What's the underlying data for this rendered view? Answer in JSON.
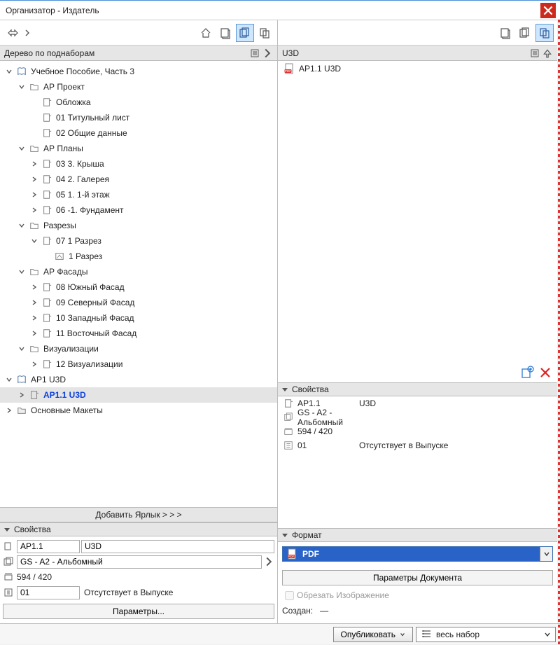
{
  "window": {
    "title": "Организатор - Издатель"
  },
  "left": {
    "header": "Дерево по поднаборам",
    "add_shortcut": "Добавить Ярлык > > >",
    "tree": [
      {
        "depth": 0,
        "expand": "open",
        "icon": "book",
        "label": "Учебное Пособие, Часть 3"
      },
      {
        "depth": 1,
        "expand": "open",
        "icon": "folder",
        "label": "АР Проект"
      },
      {
        "depth": 2,
        "expand": "none",
        "icon": "sheet",
        "label": "Обложка"
      },
      {
        "depth": 2,
        "expand": "none",
        "icon": "sheet",
        "label": "01 Титульный лист"
      },
      {
        "depth": 2,
        "expand": "none",
        "icon": "sheet",
        "label": "02 Общие данные"
      },
      {
        "depth": 1,
        "expand": "open",
        "icon": "folder",
        "label": "АР Планы"
      },
      {
        "depth": 2,
        "expand": "closed",
        "icon": "sheet",
        "label": "03 3. Крыша"
      },
      {
        "depth": 2,
        "expand": "closed",
        "icon": "sheet",
        "label": "04 2. Галерея"
      },
      {
        "depth": 2,
        "expand": "closed",
        "icon": "sheet",
        "label": "05 1. 1-й этаж"
      },
      {
        "depth": 2,
        "expand": "closed",
        "icon": "sheet",
        "label": "06 -1. Фундамент"
      },
      {
        "depth": 1,
        "expand": "open",
        "icon": "folder",
        "label": "Разрезы"
      },
      {
        "depth": 2,
        "expand": "open",
        "icon": "sheet",
        "label": "07 1 Разрез"
      },
      {
        "depth": 3,
        "expand": "none",
        "icon": "drawing",
        "label": "1 Разрез"
      },
      {
        "depth": 1,
        "expand": "open",
        "icon": "folder",
        "label": "АР Фасады"
      },
      {
        "depth": 2,
        "expand": "closed",
        "icon": "sheet",
        "label": "08 Южный Фасад"
      },
      {
        "depth": 2,
        "expand": "closed",
        "icon": "sheet",
        "label": "09 Северный Фасад"
      },
      {
        "depth": 2,
        "expand": "closed",
        "icon": "sheet",
        "label": "10 Западный Фасад"
      },
      {
        "depth": 2,
        "expand": "closed",
        "icon": "sheet",
        "label": "11 Восточный Фасад"
      },
      {
        "depth": 1,
        "expand": "open",
        "icon": "folder",
        "label": "Визуализации"
      },
      {
        "depth": 2,
        "expand": "closed",
        "icon": "sheet",
        "label": "12 Визуализации"
      },
      {
        "depth": 0,
        "expand": "open",
        "icon": "book",
        "label": "АР1 U3D"
      },
      {
        "depth": 1,
        "expand": "closed",
        "icon": "sheet",
        "label": "АР1.1 U3D",
        "selected": true
      },
      {
        "depth": 0,
        "expand": "closed",
        "icon": "closed-folder",
        "label": "Основные Макеты"
      }
    ],
    "props": {
      "header": "Свойства",
      "code": "АР1.1",
      "name": "U3D",
      "layout": "GS - A2 - Альбомный",
      "size": "594 / 420",
      "rev": "01",
      "rev_status": "Отсутствует в Выпуске",
      "params_btn": "Параметры..."
    }
  },
  "right": {
    "header": "U3D",
    "list": [
      {
        "icon": "pdf",
        "label": "АР1.1 U3D"
      }
    ],
    "props": {
      "header": "Свойства",
      "rows": [
        {
          "icon": "sheet",
          "c1": "АР1.1",
          "c2": "U3D"
        },
        {
          "icon": "layout",
          "c1": "GS - A2 - Альбомный",
          "c2": ""
        },
        {
          "icon": "size",
          "c1": "594 / 420",
          "c2": ""
        },
        {
          "icon": "rev",
          "c1": "01",
          "c2": "Отсутствует в Выпуске"
        }
      ]
    },
    "format": {
      "header": "Формат",
      "selected": "PDF",
      "doc_params_btn": "Параметры Документа",
      "crop_label": "Обрезать Изображение",
      "created_label": "Создан:",
      "created_value": "—"
    }
  },
  "footer": {
    "publish": "Опубликовать",
    "scope": "весь набор"
  }
}
